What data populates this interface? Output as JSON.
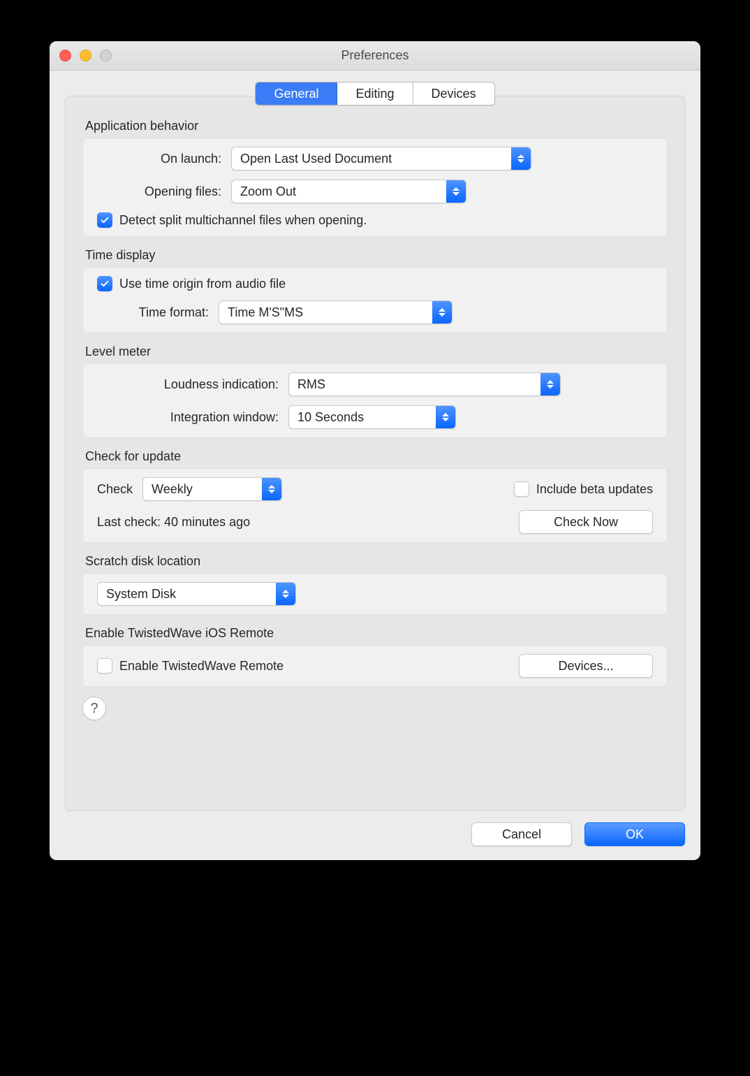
{
  "window": {
    "title": "Preferences"
  },
  "tabs": {
    "general": "General",
    "editing": "Editing",
    "devices": "Devices"
  },
  "sections": {
    "app_behavior": {
      "title": "Application behavior",
      "on_launch_label": "On launch:",
      "on_launch_value": "Open Last Used Document",
      "opening_files_label": "Opening files:",
      "opening_files_value": "Zoom Out",
      "detect_multichannel": "Detect split multichannel files when opening."
    },
    "time_display": {
      "title": "Time display",
      "use_origin": "Use time origin from audio file",
      "format_label": "Time format:",
      "format_value": "Time M'S\"MS"
    },
    "level_meter": {
      "title": "Level meter",
      "loudness_label": "Loudness indication:",
      "loudness_value": "RMS",
      "integration_label": "Integration window:",
      "integration_value": "10 Seconds"
    },
    "update": {
      "title": "Check for update",
      "check_label": "Check",
      "check_value": "Weekly",
      "include_beta": "Include beta updates",
      "last_check": "Last check: 40 minutes ago",
      "check_now": "Check Now"
    },
    "scratch": {
      "title": "Scratch disk location",
      "value": "System Disk"
    },
    "remote": {
      "title": "Enable TwistedWave iOS Remote",
      "enable_label": "Enable TwistedWave Remote",
      "devices_btn": "Devices..."
    }
  },
  "footer": {
    "cancel": "Cancel",
    "ok": "OK"
  },
  "help": "?"
}
